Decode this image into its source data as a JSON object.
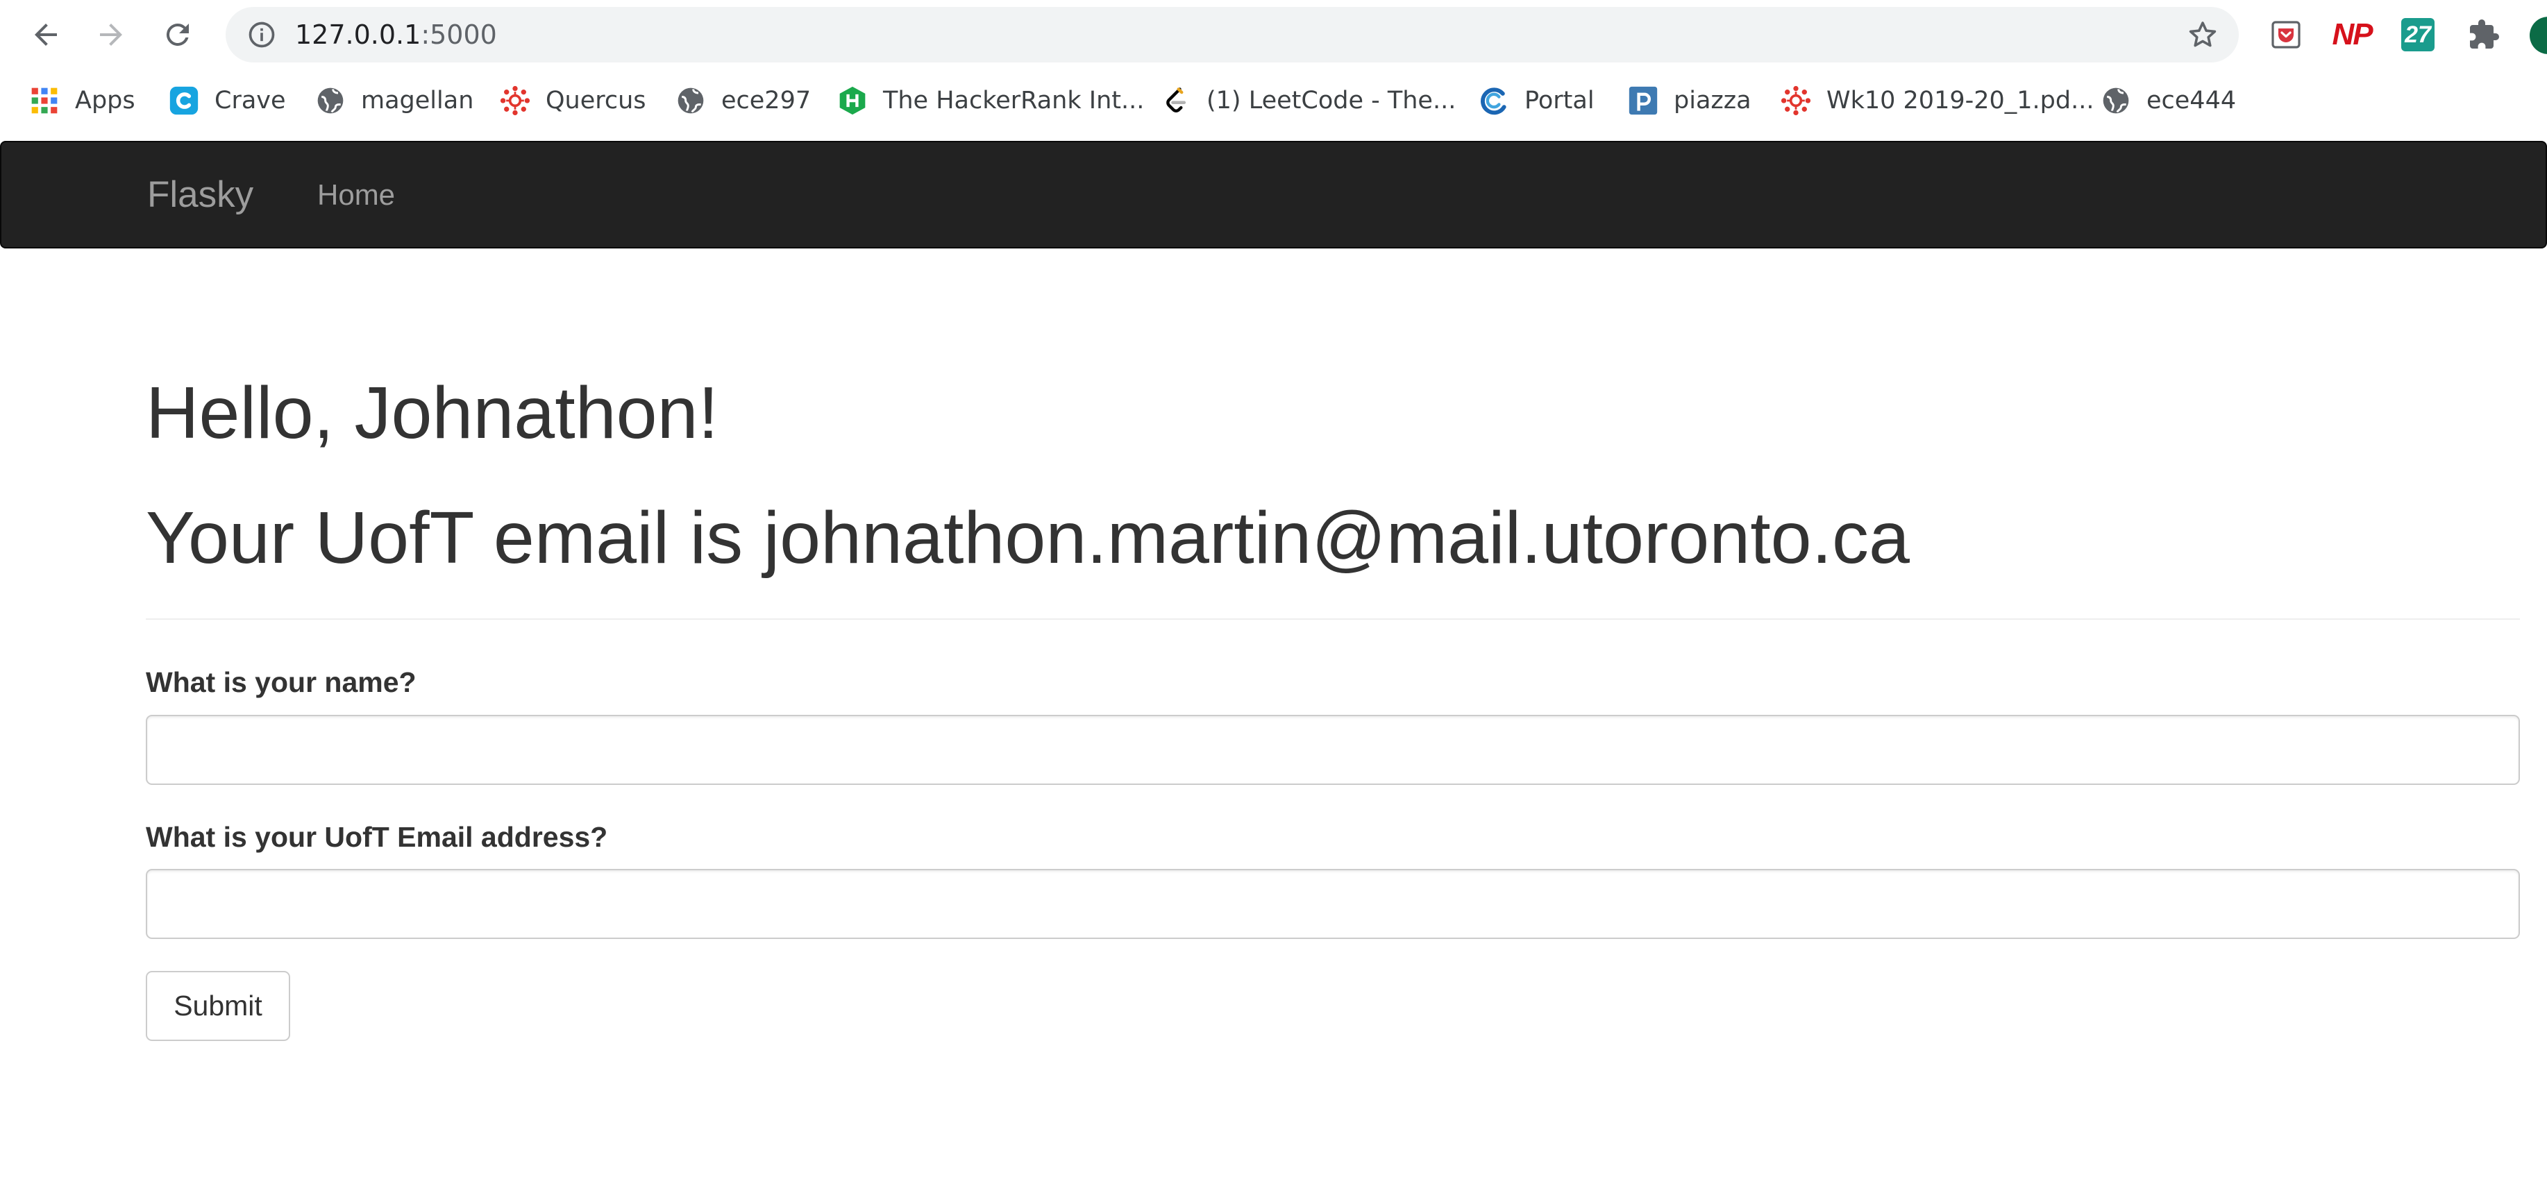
{
  "browser": {
    "url_host": "127.0.0.1",
    "url_port": ":5000",
    "icons": {
      "back": "back-arrow-icon",
      "forward": "forward-arrow-icon",
      "reload": "reload-icon",
      "site_info": "info-icon",
      "bookmark_star": "star-icon",
      "extensions": "puzzle-icon"
    },
    "extensions": {
      "np_label": "NP",
      "badge_label": "27"
    }
  },
  "bookmarks": [
    {
      "label": "Apps",
      "icon": "apps-grid-icon"
    },
    {
      "label": "Crave",
      "icon": "crave-icon"
    },
    {
      "label": "magellan",
      "icon": "globe-icon"
    },
    {
      "label": "Quercus",
      "icon": "quercus-icon"
    },
    {
      "label": "ece297",
      "icon": "globe-icon"
    },
    {
      "label": "The HackerRank Int...",
      "icon": "hackerrank-icon"
    },
    {
      "label": "(1) LeetCode - The...",
      "icon": "leetcode-icon"
    },
    {
      "label": "Portal",
      "icon": "portal-icon"
    },
    {
      "label": "piazza",
      "icon": "piazza-icon"
    },
    {
      "label": "Wk10 2019-20_1.pd...",
      "icon": "quercus-icon"
    },
    {
      "label": "ece444",
      "icon": "globe-icon"
    }
  ],
  "navbar": {
    "brand": "Flasky",
    "home": "Home"
  },
  "page": {
    "greeting": "Hello, Johnathon!",
    "email_line": "Your UofT email is johnathon.martin@mail.utoronto.ca"
  },
  "form": {
    "name_label": "What is your name?",
    "name_value": "",
    "email_label": "What is your UofT Email address?",
    "email_value": "",
    "submit_label": "Submit"
  },
  "colors": {
    "navbar_bg": "#222222",
    "navbar_text": "#9d9d9d",
    "text": "#333333",
    "omnibox_bg": "#f1f3f4"
  }
}
